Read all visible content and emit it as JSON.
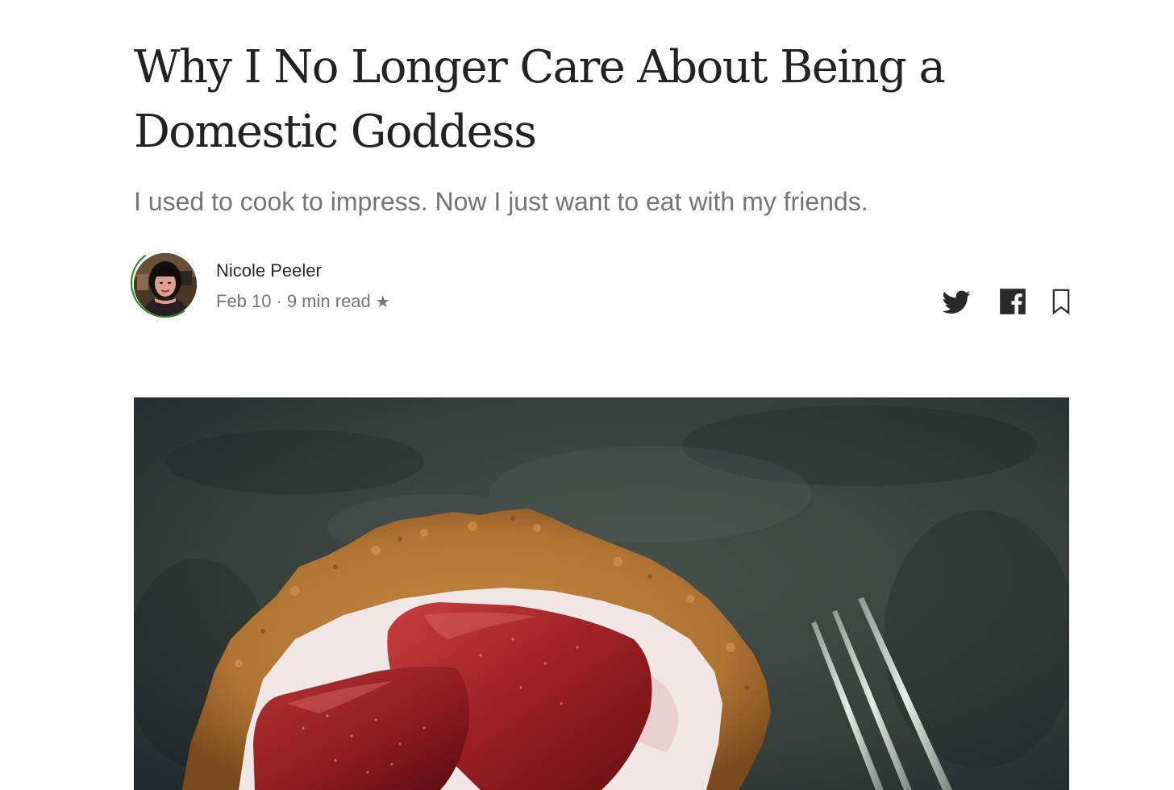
{
  "article": {
    "title": "Why I No Longer Care About Being a Domestic Goddess",
    "subtitle": "I used to cook to impress. Now I just want to eat with my friends.",
    "author": {
      "name": "Nicole Peeler",
      "date": "Feb 10",
      "separator": "·",
      "read_time": "9 min read",
      "member_star": "★",
      "avatar_ring_color": "#1a8917"
    },
    "share": {
      "twitter_icon": "twitter-icon",
      "facebook_icon": "facebook-icon",
      "bookmark_icon": "bookmark-icon"
    },
    "hero_image": {
      "subject": "strawberry-cream-tart-with-fork"
    }
  },
  "colors": {
    "title": "#222222",
    "subtitle": "#757575",
    "meta": "#757575",
    "icon": "#292929",
    "photo_background": "#353d39"
  }
}
